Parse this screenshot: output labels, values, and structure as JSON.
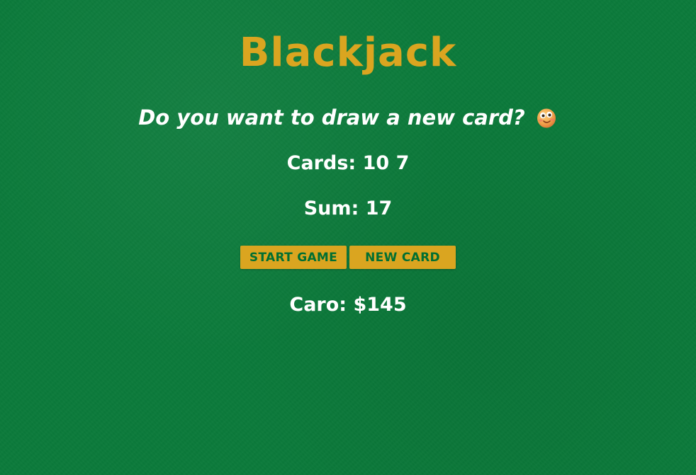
{
  "title": "Blackjack",
  "message": "Do you want to draw a new card?",
  "cards": {
    "label": "Cards:",
    "values": "10 7"
  },
  "sum": {
    "label": "Sum:",
    "value": "17"
  },
  "buttons": {
    "start_label": "START GAME",
    "new_card_label": "NEW CARD"
  },
  "player": {
    "text": "Caro: $145"
  },
  "icons": {
    "message_icon": "smiling-face-emoji-icon"
  },
  "colors": {
    "table_green": "#0b7a3b",
    "gold": "#daa520",
    "button_text": "#016f32"
  }
}
